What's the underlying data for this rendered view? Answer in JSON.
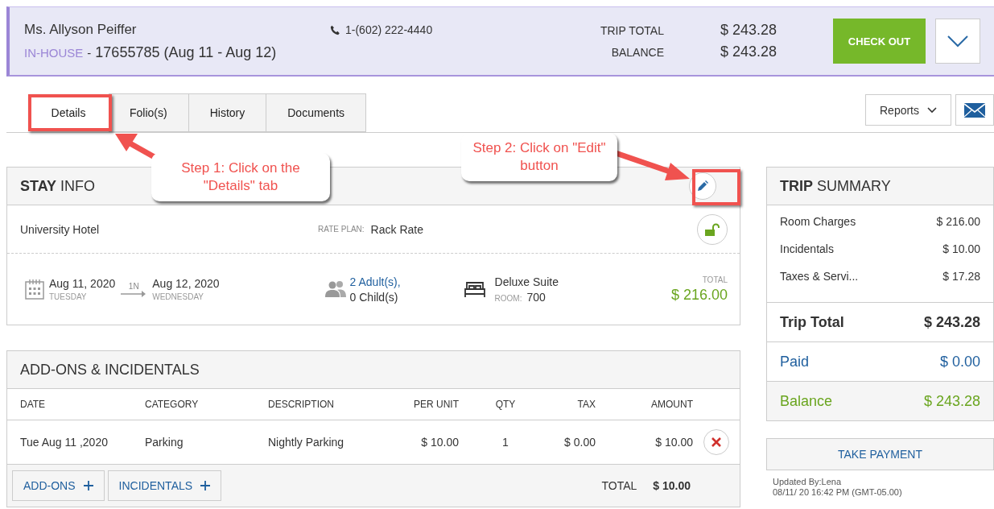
{
  "header": {
    "guest_name": "Ms. Allyson Peiffer",
    "status": "IN-HOUSE",
    "separator": "-",
    "reservation": "17655785 (Aug 11 - Aug 12)",
    "phone": "1-(602) 222-4440",
    "totals": [
      {
        "label": "TRIP TOTAL",
        "value": "$ 243.28"
      },
      {
        "label": "BALANCE",
        "value": "$ 243.28"
      }
    ],
    "checkout_button": "CHECK OUT"
  },
  "tabs": [
    {
      "label": "Details",
      "selected": true
    },
    {
      "label": "Folio(s)",
      "selected": false
    },
    {
      "label": "History",
      "selected": false
    },
    {
      "label": "Documents",
      "selected": false
    }
  ],
  "reports_button": "Reports",
  "stay_info": {
    "title": "**STAY** INFO",
    "hotel": "University Hotel",
    "rate_plan_label": "RATE PLAN:",
    "rate_plan": "Rack Rate",
    "locked": false,
    "check_in": {
      "date": "Aug 11, 2020",
      "day": "TUESDAY"
    },
    "nights": "1N",
    "check_out": {
      "date": "Aug 12, 2020",
      "day": "WEDNESDAY"
    },
    "adults": "2 Adult(s),",
    "children": "0 Child(s)",
    "room_type": "Deluxe Suite",
    "room_label": "ROOM:",
    "room": "700",
    "total_label": "TOTAL",
    "total": "$ 216.00"
  },
  "addons": {
    "title": "ADD-ONS & INCIDENTALS",
    "columns": [
      "DATE",
      "CATEGORY",
      "DESCRIPTION",
      "PER UNIT",
      "QTY",
      "TAX",
      "AMOUNT"
    ],
    "rows": [
      [
        "Tue Aug 11 ,2020",
        "Parking",
        "Nightly Parking",
        "$ 10.00",
        "1",
        "$ 0.00",
        "$ 10.00"
      ]
    ],
    "buttons": [
      "ADD-ONS",
      "INCIDENTALS"
    ],
    "total_label": "TOTAL",
    "total": "$ 10.00"
  },
  "trip_summary": {
    "title": "**TRIP** SUMMARY",
    "charges": [
      {
        "label": "Room Charges",
        "value": "$ 216.00"
      },
      {
        "label": "Incidentals",
        "value": "$ 10.00"
      },
      {
        "label": "Taxes & Servi...",
        "value": "$ 17.28"
      }
    ],
    "totals": [
      {
        "kind": "total",
        "label": "Trip Total",
        "value": "$ 243.28"
      },
      {
        "kind": "paid",
        "label": "Paid",
        "value": "$ 0.00"
      },
      {
        "kind": "balance",
        "label": "Balance",
        "value": "$ 243.28"
      }
    ],
    "take_payment": "TAKE PAYMENT",
    "updated_by": "Updated By:Lena",
    "updated_at": "08/11/ 20 16:42 PM (GMT-05.00)"
  },
  "annotations": [
    {
      "text": "Step 1: Click on the \"Details\" tab"
    },
    {
      "text": "Step 2: Click on \"Edit\" button"
    }
  ]
}
